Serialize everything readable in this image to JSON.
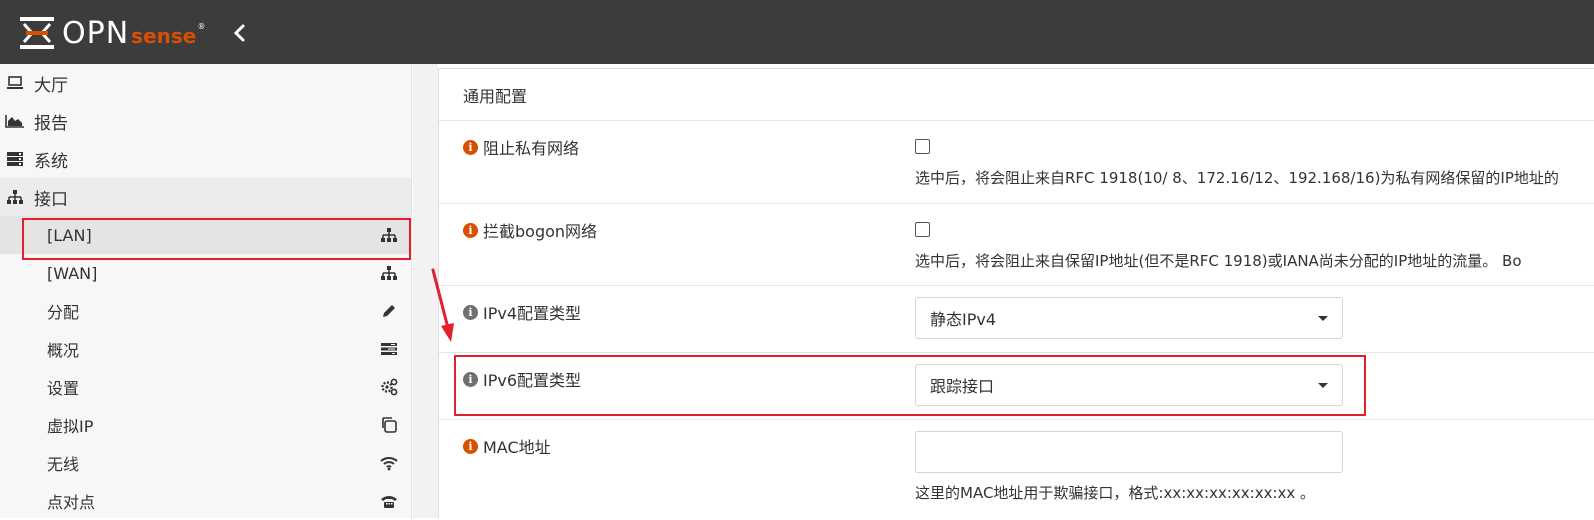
{
  "header": {
    "brand_main": "OPN",
    "brand_accent": "sense",
    "brand_reg": "®"
  },
  "colors": {
    "topbar": "#3c3c3c",
    "accent": "#d94f00",
    "highlight_red": "#e0202a"
  },
  "sidebar": {
    "top_items": [
      {
        "label": "大厅",
        "icon": "laptop-icon"
      },
      {
        "label": "报告",
        "icon": "area-chart-icon"
      },
      {
        "label": "系统",
        "icon": "server-icon"
      },
      {
        "label": "接口",
        "icon": "sitemap-icon"
      }
    ],
    "sub_items": [
      {
        "label": "[LAN]",
        "icon": "sitemap-icon"
      },
      {
        "label": "[WAN]",
        "icon": "sitemap-icon"
      },
      {
        "label": "分配",
        "icon": "pencil-icon"
      },
      {
        "label": "概况",
        "icon": "tasks-icon"
      },
      {
        "label": "设置",
        "icon": "cogs-icon"
      },
      {
        "label": "虚拟IP",
        "icon": "clone-icon"
      },
      {
        "label": "无线",
        "icon": "wifi-icon"
      },
      {
        "label": "点对点",
        "icon": "phone-icon"
      }
    ]
  },
  "main": {
    "section_title": "通用配置",
    "block_private": {
      "label": "阻止私有网络",
      "checked": false,
      "help": "选中后，将会阻止来自RFC 1918(10/ 8、172.16/12、192.168/16)为私有网络保留的IP地址的"
    },
    "block_bogon": {
      "label": "拦截bogon网络",
      "checked": false,
      "help": "选中后，将会阻止来自保留IP地址(但不是RFC 1918)或IANA尚未分配的IP地址的流量。 Bo"
    },
    "ipv4_type": {
      "label": "IPv4配置类型",
      "value": "静态IPv4"
    },
    "ipv6_type": {
      "label": "IPv6配置类型",
      "value": "跟踪接口"
    },
    "mac": {
      "label": "MAC地址",
      "value": "",
      "help": "这里的MAC地址用于欺骗接口，格式:xx:xx:xx:xx:xx:xx 。"
    }
  }
}
